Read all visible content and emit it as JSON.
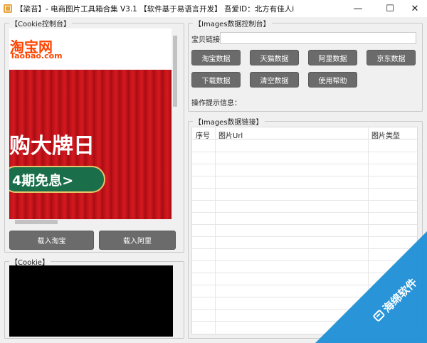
{
  "window": {
    "title": "【梁苔】- 电商图片工具箱合集 V3.1    【软件基于易语言开发】    吾爱ID：北方有佳人i",
    "minimize_symbol": "—",
    "maximize_symbol": "☐",
    "close_symbol": "✕"
  },
  "cookie_console": {
    "title": "【Cookie控制台】",
    "logo_cn": "淘宝网",
    "logo_en": "Taobao.com",
    "banner_text": "购大牌日",
    "banner_promo": "4期免息>",
    "load_taobao": "载入淘宝",
    "load_ali": "载入阿里"
  },
  "cookie_box": {
    "title": "【Cookie】"
  },
  "images_console": {
    "title": "【Images数据控制台】",
    "link_label": "宝贝链接：",
    "link_value": "",
    "buttons": [
      "淘宝数据",
      "天猫数据",
      "阿里数据",
      "京东数据",
      "下载数据",
      "清空数据",
      "使用帮助"
    ],
    "hint_label": "操作提示信息："
  },
  "images_links": {
    "title": "【Images数据链接】",
    "columns": [
      "序号",
      "图片Url",
      "图片类型"
    ]
  },
  "watermark": {
    "text": "海绵软件",
    "icon": "sponge-logo-icon"
  }
}
